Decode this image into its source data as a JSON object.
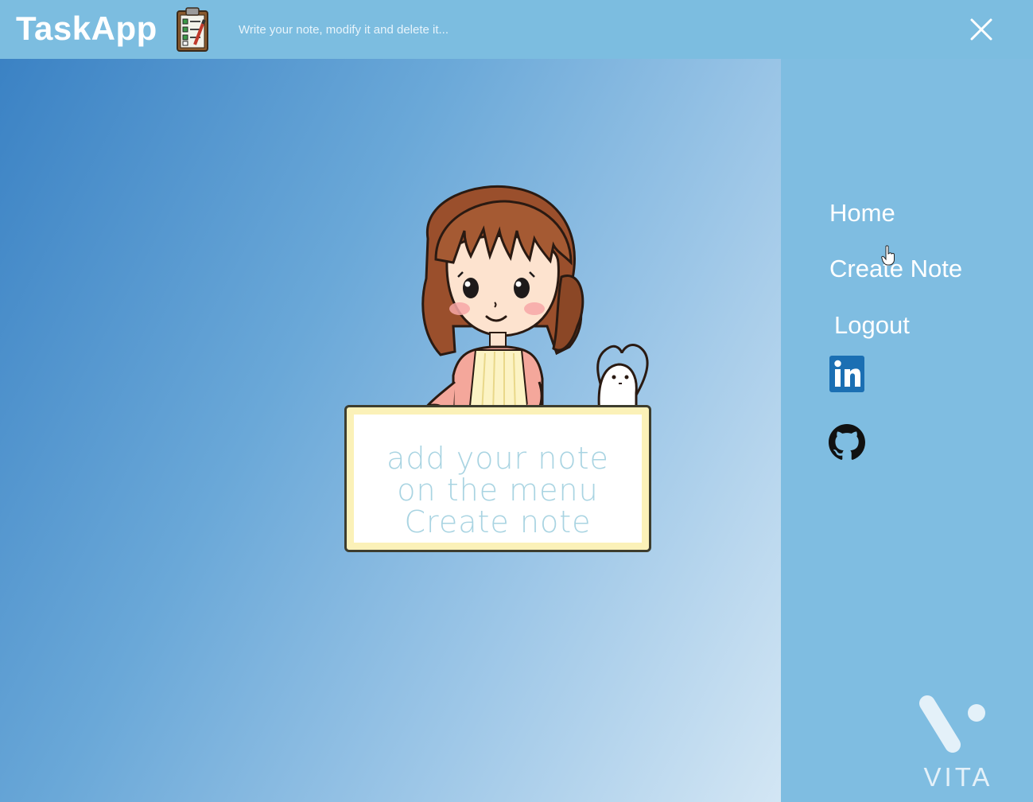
{
  "navbar": {
    "brand": "TaskApp",
    "tagline": "Write your note, modify it and delete it...",
    "icons": {
      "app": "clipboard-checklist-icon",
      "close": "close-icon"
    }
  },
  "note_card": {
    "lines": [
      "add your note",
      "on the menu",
      "Create note"
    ]
  },
  "sidebar": {
    "links": [
      {
        "label": "Home"
      },
      {
        "label": "Create Note"
      },
      {
        "label": "Logout"
      }
    ],
    "social": [
      {
        "icon": "linkedin-icon",
        "text": "in"
      },
      {
        "icon": "github-icon"
      }
    ]
  },
  "watermark": {
    "label": "VITA"
  },
  "colors": {
    "navbar": "#7cbde0",
    "sidebar": "#7fbde1",
    "accent_dark": "#3b82c4",
    "note_text": "#a9d4e2"
  }
}
